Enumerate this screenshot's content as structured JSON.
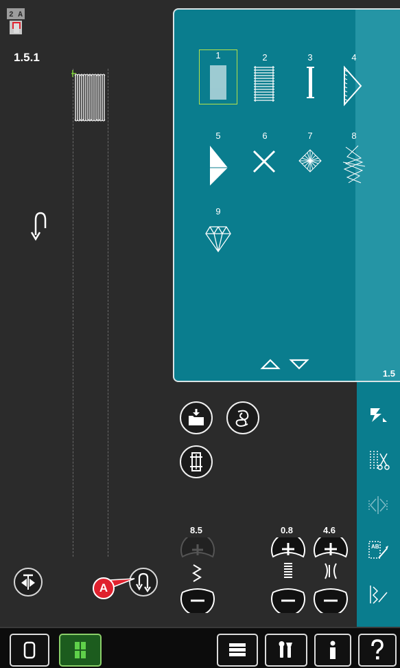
{
  "left_panel": {
    "stitch_number": "1.5.1",
    "presser_foot_label": "2 A",
    "callout_label": "A"
  },
  "stitch_menu": {
    "category_label": "1.5",
    "stitches": [
      {
        "number": "1",
        "selected": true
      },
      {
        "number": "2",
        "selected": false
      },
      {
        "number": "3",
        "selected": false
      },
      {
        "number": "4",
        "selected": false
      },
      {
        "number": "5",
        "selected": false
      },
      {
        "number": "6",
        "selected": false
      },
      {
        "number": "7",
        "selected": false
      },
      {
        "number": "8",
        "selected": false
      },
      {
        "number": "9",
        "selected": false
      }
    ]
  },
  "settings": {
    "stitch_width": "8.5",
    "stitch_length": "0.8",
    "stitch_density": "4.6"
  },
  "colors": {
    "panel_teal": "#0a7d8e",
    "strip_teal": "#2595a5",
    "callout_red": "#e0212e",
    "active_green": "#1c5c1e"
  }
}
